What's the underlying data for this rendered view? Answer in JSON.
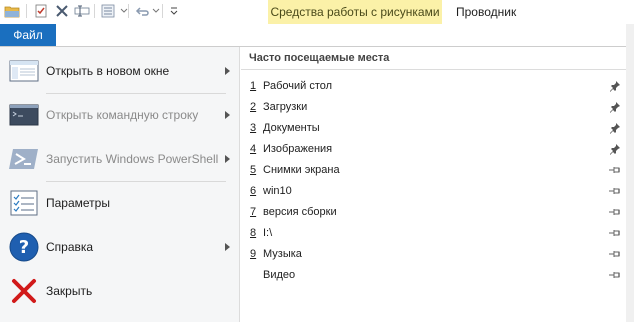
{
  "ribbon": {
    "context_tab": "Средства работы с рисунками",
    "explorer_tab": "Проводник",
    "file_tab": "Файл"
  },
  "menu": {
    "items": [
      {
        "label": "Открыть в новом окне",
        "icon": "new-window-icon",
        "submenu": true,
        "enabled": true
      },
      {
        "label": "Открыть командную строку",
        "icon": "command-prompt-icon",
        "submenu": true,
        "enabled": false
      },
      {
        "label": "Запустить Windows PowerShell",
        "icon": "powershell-icon",
        "submenu": true,
        "enabled": false
      },
      {
        "label": "Параметры",
        "icon": "options-icon",
        "submenu": false,
        "enabled": true
      },
      {
        "label": "Справка",
        "icon": "help-icon",
        "submenu": true,
        "enabled": true
      },
      {
        "label": "Закрыть",
        "icon": "close-icon",
        "submenu": false,
        "enabled": true
      }
    ]
  },
  "recent": {
    "title": "Часто посещаемые места",
    "items": [
      {
        "num": "1",
        "name": "Рабочий стол",
        "pinned": true
      },
      {
        "num": "2",
        "name": "Загрузки",
        "pinned": true
      },
      {
        "num": "3",
        "name": "Документы",
        "pinned": true
      },
      {
        "num": "4",
        "name": "Изображения",
        "pinned": true
      },
      {
        "num": "5",
        "name": "Снимки экрана",
        "pinned": false
      },
      {
        "num": "6",
        "name": "win10",
        "pinned": false
      },
      {
        "num": "7",
        "name": "версия сборки",
        "pinned": false
      },
      {
        "num": "8",
        "name": "I:\\",
        "pinned": false
      },
      {
        "num": "9",
        "name": "Музыка",
        "pinned": false
      },
      {
        "num": "",
        "name": "Видео",
        "pinned": false
      }
    ]
  },
  "colors": {
    "file_tab": "#1a6fbf",
    "context_tab": "#fbf1a8",
    "left_pane": "#f5f6f7"
  }
}
